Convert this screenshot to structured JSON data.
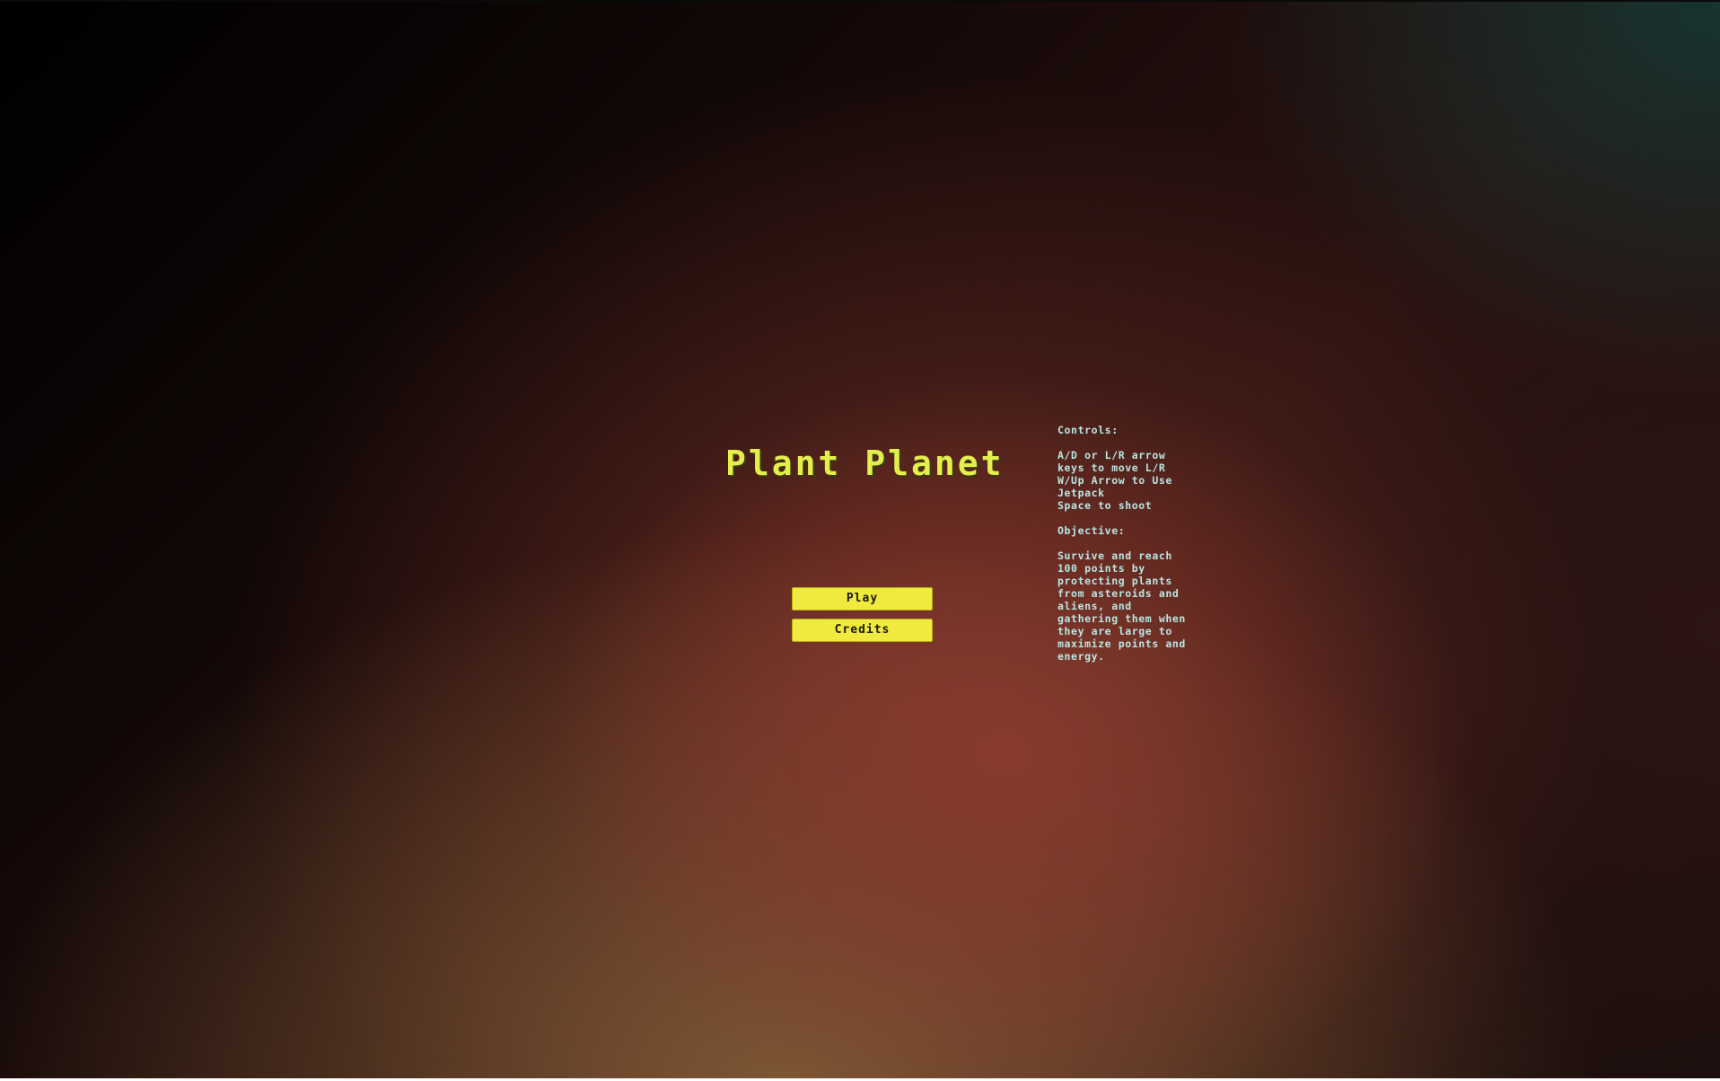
{
  "game": {
    "title": "Plant Planet"
  },
  "menu": {
    "play_label": "Play",
    "credits_label": "Credits"
  },
  "info": {
    "controls_heading": "Controls:",
    "controls_lines": [
      "A/D or L/R arrow",
      "keys to move L/R",
      "W/Up Arrow to Use",
      "Jetpack",
      "Space to shoot"
    ],
    "objective_heading": "Objective:",
    "objective_lines": [
      "Survive and reach",
      "100 points by",
      "protecting plants",
      "from asteroids and",
      "aliens, and",
      "gathering them when",
      "they are large to",
      "maximize points and",
      "energy."
    ]
  },
  "colors": {
    "title": "#e4ef4c",
    "button_fill": "#f0ea3e",
    "info_text": "#b9e6e2"
  }
}
